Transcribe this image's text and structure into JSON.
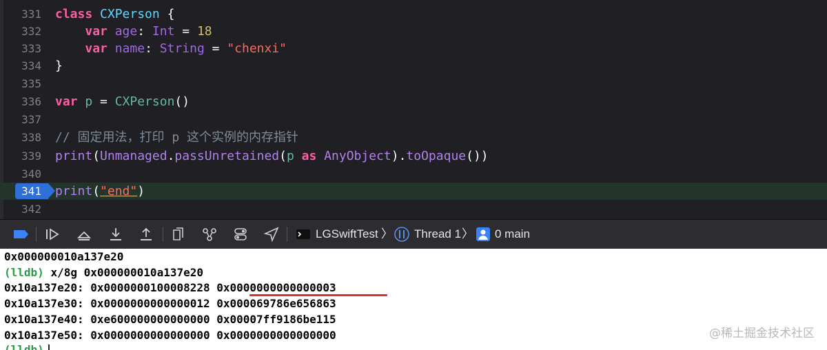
{
  "editor": {
    "lines": [
      {
        "n": "331"
      },
      {
        "n": "332"
      },
      {
        "n": "333"
      },
      {
        "n": "334"
      },
      {
        "n": "335"
      },
      {
        "n": "336"
      },
      {
        "n": "337"
      },
      {
        "n": "338"
      },
      {
        "n": "339"
      },
      {
        "n": "340"
      },
      {
        "n": "341"
      },
      {
        "n": "342"
      }
    ],
    "tokens": {
      "class_kw": "class",
      "cxperson": "CXPerson",
      "brace_open": " {",
      "var1": "var",
      "age": "age",
      "colon1": ": ",
      "int_type": "Int",
      "eq1": " = ",
      "age_val": "18",
      "var2": "var",
      "name": "name",
      "colon2": ": ",
      "string_type": "String",
      "eq2": " = ",
      "name_val": "\"chenxi\"",
      "brace_close": "}",
      "var3": "var",
      "p": "p",
      "eq3": " = ",
      "cxperson_call": "CXPerson",
      "parens": "()",
      "comment": "// 固定用法，打印 p 这个实例的内存指针",
      "print1": "print",
      "lp1": "(",
      "unmanaged": "Unmanaged",
      "dot1": ".",
      "pass_unretained": "passUnretained",
      "lp2": "(",
      "p2": "p",
      "as_kw": " as ",
      "anyobject": "AnyObject",
      "rp1": ").",
      "to_opaque": "toOpaque",
      "rp2": "())",
      "print2": "print",
      "lp3": "(",
      "end_str": "\"end\"",
      "rp3": ")"
    }
  },
  "toolbar": {
    "target_name": "LGSwiftTest",
    "thread": "Thread 1",
    "frame": "0 main",
    "chevron": "〉"
  },
  "console": {
    "lines": [
      "0x000000010a137e20",
      "x/8g 0x000000010a137e20",
      "0x10a137e20: 0x0000000100008228 ",
      "0x0000000000000003",
      "0x10a137e30: 0x0000000000000012 0x000069786e656863",
      "0x10a137e40: 0xe600000000000000 0x00007ff9186be115",
      "0x10a137e50: 0x0000000000000000 0x0000000000000000"
    ],
    "prompt": "(lldb)"
  },
  "watermark": "@稀土掘金技术社区",
  "colors": {
    "accent": "#2f6fd8",
    "current_line": "#23352a",
    "underline": "#e0302a"
  }
}
